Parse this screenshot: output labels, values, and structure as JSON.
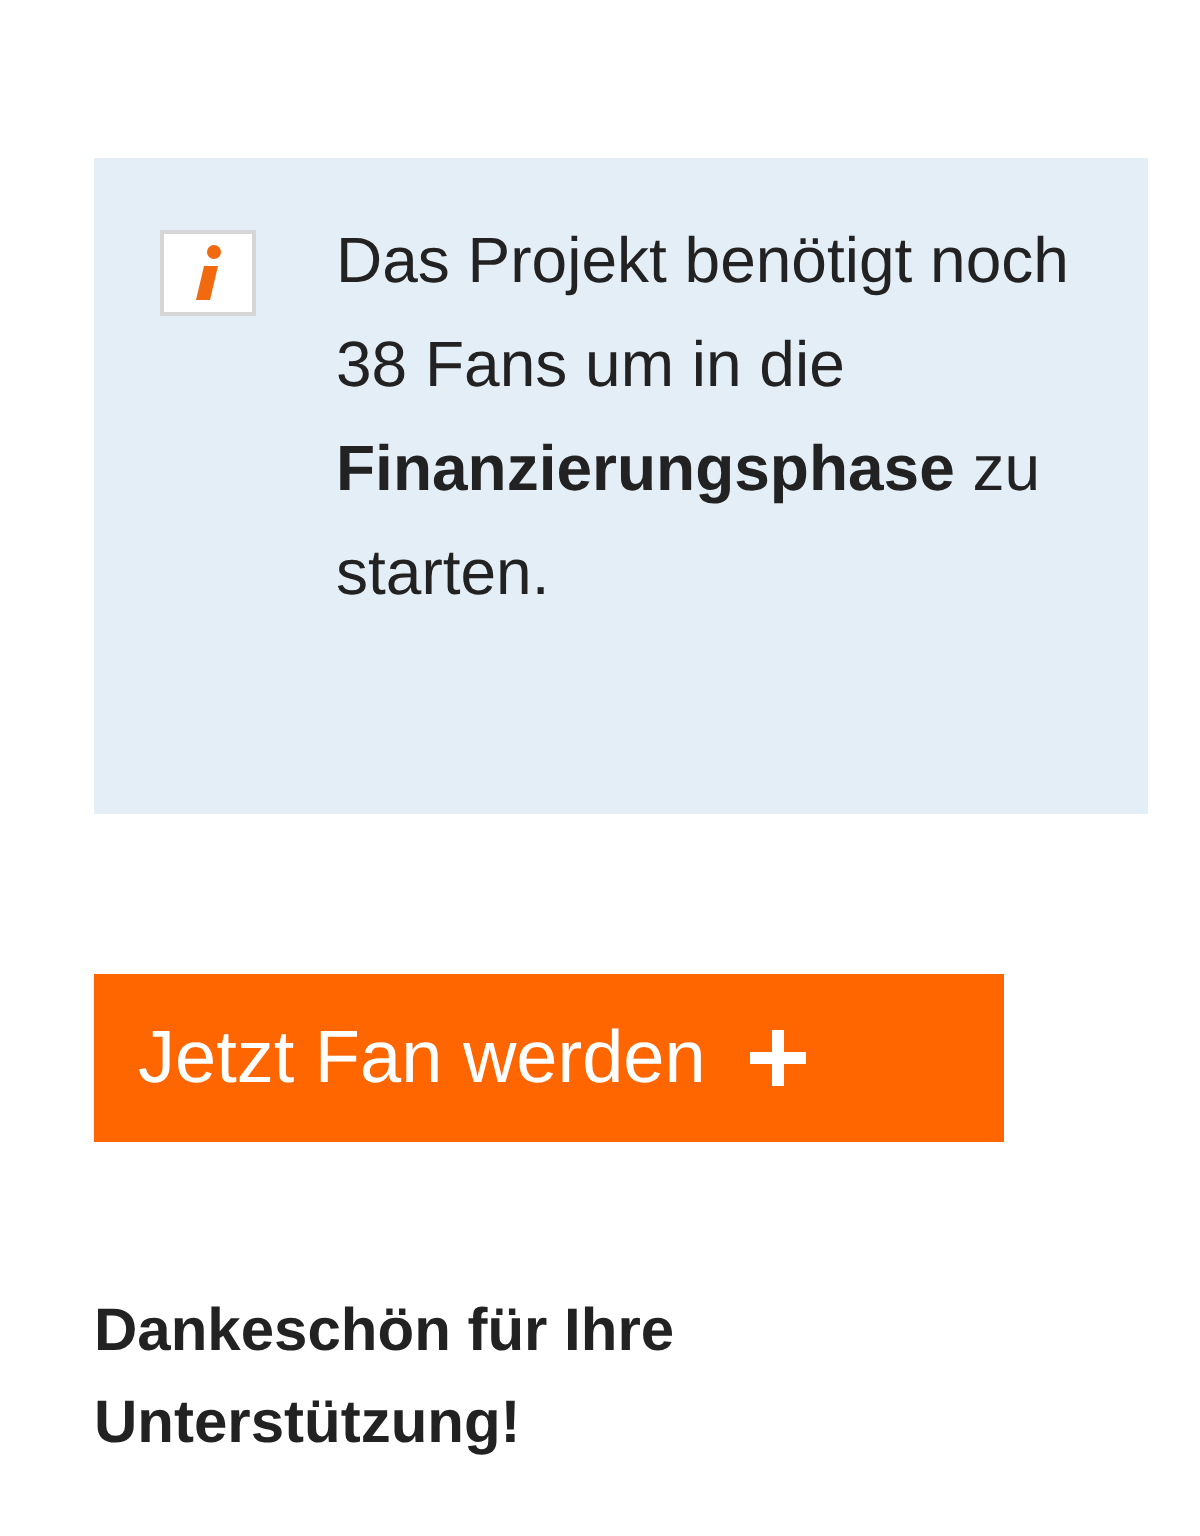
{
  "notice": {
    "text": "Das Projekt benötigt noch 38 Fans um in die **Finanzierungsphase** zu starten."
  },
  "fan_button": {
    "label": "Jetzt Fan werden"
  },
  "thanks": {
    "text": "Dankeschön für Ihre Unterstützung!"
  }
}
